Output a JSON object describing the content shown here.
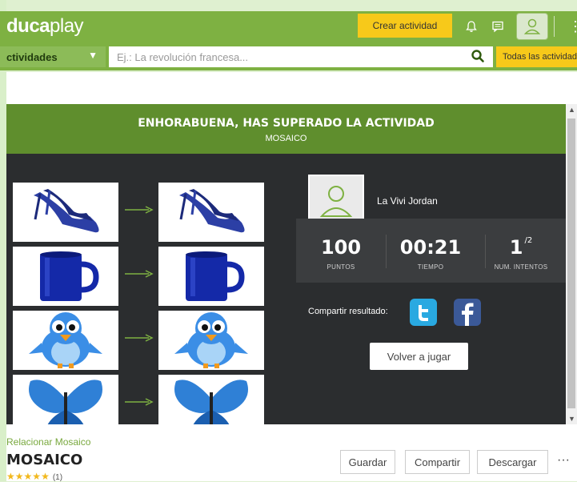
{
  "brand": {
    "logo_bold": "duca",
    "logo_light": "play",
    "accent": "#7eb142",
    "yellow": "#f7c91a"
  },
  "header": {
    "create_label": "Crear actividad",
    "icons": [
      "bell-icon",
      "chat-icon",
      "user-icon",
      "more-icon"
    ]
  },
  "search": {
    "category": "ctividades",
    "placeholder": "Ej.: La revolución francesa...",
    "scope_button": "Todas las actividades"
  },
  "result": {
    "title": "ENHORABUENA, HAS SUPERADO LA ACTIVIDAD",
    "subtitle": "MOSAICO",
    "player": "La Vivi Jordan",
    "stats": [
      {
        "value": "100",
        "label": "PUNTOS"
      },
      {
        "value": "00:21",
        "label": "TIEMPO"
      },
      {
        "value": "1",
        "suffix": "/2",
        "label": "NUM. INTENTOS"
      }
    ],
    "share_label": "Compartir resultado:",
    "replay_label": "Volver a jugar"
  },
  "pairs": [
    {
      "item": "blue-high-heel-shoes"
    },
    {
      "item": "blue-mug"
    },
    {
      "item": "blue-bird"
    },
    {
      "item": "blue-butterfly"
    }
  ],
  "activity": {
    "type": "Relacionar Mosaico",
    "title": "MOSAICO",
    "rating_count": "(1)",
    "stars": 5,
    "buttons": {
      "save": "Guardar",
      "share": "Compartir",
      "download": "Descargar"
    },
    "more": "···"
  }
}
